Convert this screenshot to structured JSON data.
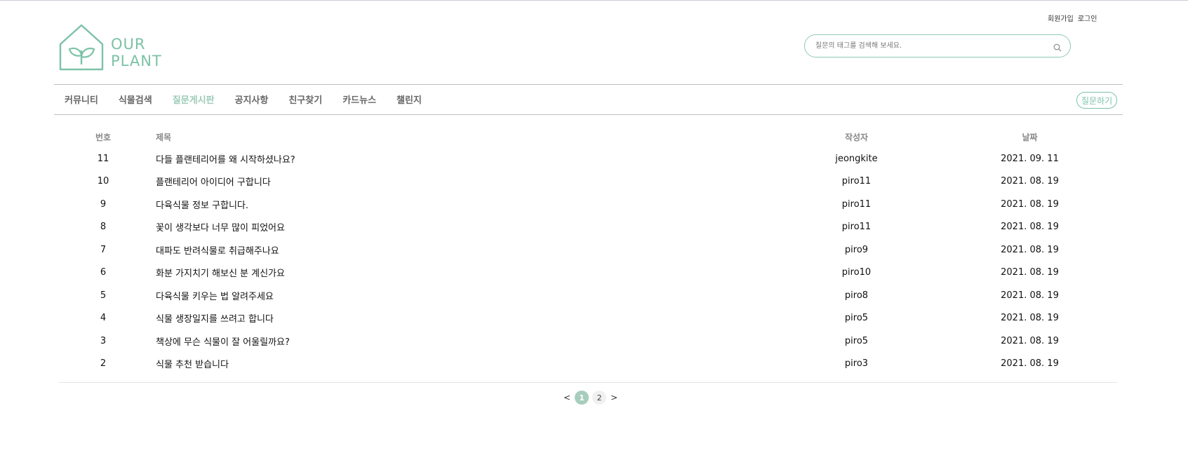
{
  "auth": {
    "signup": "회원가입",
    "login": "로그인"
  },
  "logo": {
    "line1": "OUR",
    "line2": "PLANT"
  },
  "search": {
    "placeholder": "질문의 태그를 검색해 보세요.",
    "value": ""
  },
  "nav": {
    "items": [
      "커뮤니티",
      "식물검색",
      "질문게시판",
      "공지사항",
      "친구찾기",
      "카드뉴스",
      "챌린지"
    ],
    "active": "질문게시판"
  },
  "ask_button": "질문하기",
  "table": {
    "headers": {
      "num": "번호",
      "title": "제목",
      "author": "작성자",
      "date": "날짜"
    },
    "rows": [
      {
        "num": "11",
        "title": "다들 플랜테리어를 왜 시작하셨나요?",
        "author": "jeongkite",
        "date": "2021. 09. 11"
      },
      {
        "num": "10",
        "title": "플랜테리어 아이디어 구합니다",
        "author": "piro11",
        "date": "2021. 08. 19"
      },
      {
        "num": "9",
        "title": "다육식물 정보 구합니다.",
        "author": "piro11",
        "date": "2021. 08. 19"
      },
      {
        "num": "8",
        "title": "꽃이 생각보다 너무 많이 피었어요",
        "author": "piro11",
        "date": "2021. 08. 19"
      },
      {
        "num": "7",
        "title": "대파도 반려식물로 취급해주나요",
        "author": "piro9",
        "date": "2021. 08. 19"
      },
      {
        "num": "6",
        "title": "화분 가지치기 해보신 분 계신가요",
        "author": "piro10",
        "date": "2021. 08. 19"
      },
      {
        "num": "5",
        "title": "다육식물 키우는 법 알려주세요",
        "author": "piro8",
        "date": "2021. 08. 19"
      },
      {
        "num": "4",
        "title": "식물 생장일지를 쓰려고 합니다",
        "author": "piro5",
        "date": "2021. 08. 19"
      },
      {
        "num": "3",
        "title": "책상에 무슨 식물이 잘 어울릴까요?",
        "author": "piro5",
        "date": "2021. 08. 19"
      },
      {
        "num": "2",
        "title": "식물 추천 받습니다",
        "author": "piro3",
        "date": "2021. 08. 19"
      }
    ]
  },
  "pagination": {
    "prev": "<",
    "next": ">",
    "pages": [
      "1",
      "2"
    ],
    "current": "1"
  },
  "colors": {
    "accent": "#7cc2a7",
    "nav_active": "#9ccbb8",
    "page_current": "#a6cdbd"
  },
  "icons": {
    "search": "search-icon",
    "logo": "house-sprout-icon"
  }
}
